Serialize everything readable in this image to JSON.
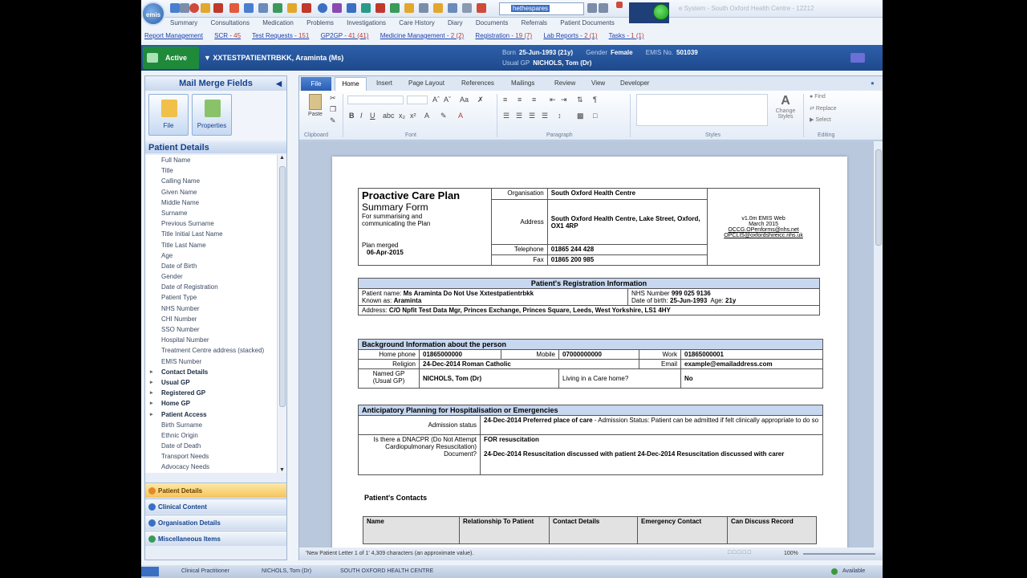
{
  "app": {
    "logo_text": "emis",
    "window_title": "e System - South Oxford Health Centre - 12212",
    "search_text": "hethespares"
  },
  "nav_tabs": [
    "Summary",
    "Consultations",
    "Medication",
    "Problems",
    "Investigations",
    "Care History",
    "Diary",
    "Documents",
    "Referrals",
    "Patient Documents"
  ],
  "status_links": [
    {
      "label": "Report Management",
      "counts": ""
    },
    {
      "label": "SCR",
      "counts": "45"
    },
    {
      "label": "Test Requests",
      "counts": "151"
    },
    {
      "label": "GP2GP",
      "counts": "41 (41)"
    },
    {
      "label": "Medicine Management",
      "counts": "2 (2)"
    },
    {
      "label": "Registration",
      "counts": "19 (7)"
    },
    {
      "label": "Lab Reports",
      "counts": "2 (1)"
    },
    {
      "label": "Tasks",
      "counts": "1 (1)"
    }
  ],
  "patient_banner": {
    "status": "Active",
    "name": "XXTESTPATIENTRBKK, Araminta (Ms)",
    "born_label": "Born",
    "born": "25-Jun-1993 (21y)",
    "gender_label": "Gender",
    "gender": "Female",
    "emis_label": "EMIS No.",
    "emis_no": "501039",
    "gp_label": "Usual GP",
    "gp": "NICHOLS, Tom (Dr)"
  },
  "mail_merge": {
    "title": "Mail Merge Fields",
    "btn_file": "File",
    "btn_properties": "Properties",
    "patient_details_header": "Patient Details",
    "fields": [
      {
        "label": "Full Name",
        "group": false
      },
      {
        "label": "Title",
        "group": false
      },
      {
        "label": "Calling Name",
        "group": false
      },
      {
        "label": "Given Name",
        "group": false
      },
      {
        "label": "Middle Name",
        "group": false
      },
      {
        "label": "Surname",
        "group": false
      },
      {
        "label": "Previous Surname",
        "group": false
      },
      {
        "label": "Title Initial Last Name",
        "group": false
      },
      {
        "label": "Title Last Name",
        "group": false
      },
      {
        "label": "Age",
        "group": false
      },
      {
        "label": "Date of Birth",
        "group": false
      },
      {
        "label": "Gender",
        "group": false
      },
      {
        "label": "Date of Registration",
        "group": false
      },
      {
        "label": "Patient Type",
        "group": false
      },
      {
        "label": "NHS Number",
        "group": false
      },
      {
        "label": "CHI Number",
        "group": false
      },
      {
        "label": "SSO Number",
        "group": false
      },
      {
        "label": "Hospital Number",
        "group": false
      },
      {
        "label": "Treatment Centre address (stacked)",
        "group": false
      },
      {
        "label": "EMIS Number",
        "group": false
      },
      {
        "label": "Contact Details",
        "group": true
      },
      {
        "label": "Usual GP",
        "group": true
      },
      {
        "label": "Registered GP",
        "group": true
      },
      {
        "label": "Home GP",
        "group": true
      },
      {
        "label": "Patient Access",
        "group": true
      },
      {
        "label": "Birth Surname",
        "group": false
      },
      {
        "label": "Ethnic Origin",
        "group": false
      },
      {
        "label": "Date of Death",
        "group": false
      },
      {
        "label": "Transport Needs",
        "group": false
      },
      {
        "label": "Advocacy Needs",
        "group": false
      }
    ],
    "sections": [
      {
        "label": "Patient Details",
        "active": true
      },
      {
        "label": "Clinical Content",
        "active": false
      },
      {
        "label": "Organisation Details",
        "active": false
      },
      {
        "label": "Miscellaneous Items",
        "active": false
      }
    ]
  },
  "ribbon": {
    "tabs": [
      "File",
      "Home",
      "Insert",
      "Page Layout",
      "References",
      "Mailings",
      "Review",
      "View",
      "Developer"
    ],
    "groups": [
      "Clipboard",
      "Font",
      "Paragraph",
      "Styles",
      "Editing"
    ],
    "paste": "Paste",
    "change_styles": "Change Styles",
    "find": "Find",
    "replace": "Replace",
    "select": "Select"
  },
  "document": {
    "form_title": "Proactive Care Plan",
    "form_subtitle": "Summary Form",
    "form_desc": "For summarising and communicating the Plan",
    "merged_label": "Plan merged",
    "merged_date": "06-Apr-2015",
    "org_label": "Organisation",
    "org": "South Oxford Health Centre",
    "address_label": "Address",
    "address": "South Oxford Health Centre, Lake Street, Oxford, OX1 4RP",
    "phone_label": "Telephone",
    "phone": "01865 244 428",
    "fax_label": "Fax",
    "fax": "01865 200 985",
    "version": "v1.0m EMIS Web",
    "version_date": "March 2015",
    "email1": "OCCG.OPenforms@nhs.net",
    "email2": "OPCLIS@oxfordshireicc.nhs.uk",
    "reg_header": "Patient's Registration Information",
    "patient_name_label": "Patient name:",
    "patient_name": "Ms Araminta  Do Not Use Xxtestpatientrbkk",
    "known_as_label": "Known as:",
    "known_as": "Araminta",
    "nhs_label": "NHS Number",
    "nhs": "999 025 9136",
    "dob_label": "Date of birth:",
    "dob": "25-Jun-1993",
    "age_label": "Age:",
    "age": "21y",
    "addr_label": "Address:",
    "patient_address": "C/O Npfit Test Data Mgr, Princes Exchange, Princes Square, Leeds, West Yorkshire, LS1 4HY",
    "bg_header": "Background Information  about the person",
    "home_phone_label": "Home phone",
    "home_phone": "01865000000",
    "mobile_label": "Mobile",
    "mobile": "07000000000",
    "work_label": "Work",
    "work": "01865000001",
    "religion_label": "Religion",
    "religion": "24-Dec-2014 Roman Catholic",
    "email_label": "Email",
    "email": "example@emailaddress.com",
    "named_gp_label": "Named GP\n(Usual GP)",
    "named_gp": "NICHOLS, Tom (Dr)",
    "care_home_label": "Living in a Care home?",
    "care_home": "No",
    "ant_header": "Anticipatory  Planning for Hospitalisation  or Emergencies",
    "admission_label": "Admission status",
    "admission_bold": "24-Dec-2014 Preferred place of care",
    "admission_rest": " - Admission Status: Patient can be admitted if felt clinically appropriate to do so",
    "dnacpr_label": "Is there a DNACPR (Do Not Attempt Cardiopulmonary Resuscitation) Document?",
    "dnacpr_1": "FOR resuscitation",
    "dnacpr_2": "24-Dec-2014 Resuscitation discussed with patient 24-Dec-2014 Resuscitation discussed with carer",
    "contacts_title": "Patient's Contacts",
    "contacts_cols": [
      "Name",
      "Relationship To Patient",
      "Contact Details",
      "Emergency Contact",
      "Can Discuss Record"
    ]
  },
  "status_bar": {
    "text": "'New Patient Letter 1 of 1'  4,309 characters (an approximate value).",
    "zoom": "100%"
  },
  "taskbar": {
    "role": "Clinical Practitioner",
    "user": "NICHOLS, Tom (Dr)",
    "org": "SOUTH OXFORD HEALTH CENTRE",
    "availability": "Available"
  }
}
